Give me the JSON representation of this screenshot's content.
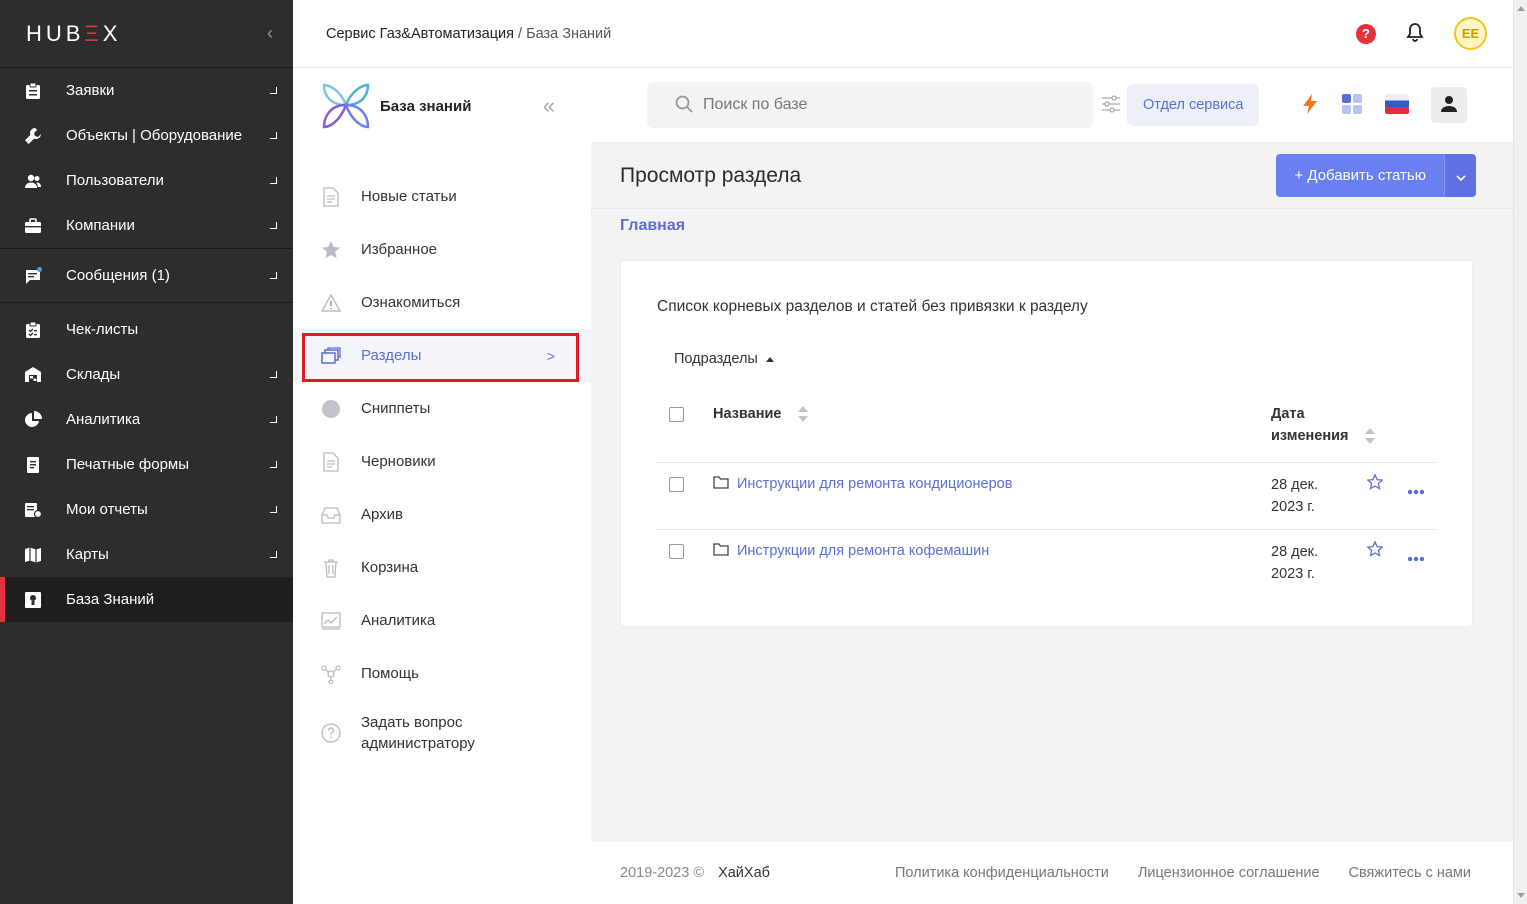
{
  "app": {
    "logo": {
      "part1": "HUB",
      "part2": "Ξ",
      "part3": "X"
    },
    "collapse_glyph": "‹"
  },
  "sidebar": {
    "items": [
      {
        "label": "Заявки",
        "icon": "clipboard-icon"
      },
      {
        "label": "Объекты | Оборудование",
        "icon": "wrench-icon"
      },
      {
        "label": "Пользователи",
        "icon": "users-icon"
      },
      {
        "label": "Компании",
        "icon": "briefcase-icon"
      },
      {
        "label": "Сообщения (1)",
        "icon": "chat-icon"
      },
      {
        "label": "Чек-листы",
        "icon": "checklist-icon"
      },
      {
        "label": "Склады",
        "icon": "warehouse-icon"
      },
      {
        "label": "Аналитика",
        "icon": "pie-chart-icon"
      },
      {
        "label": "Печатные формы",
        "icon": "print-form-icon"
      },
      {
        "label": "Мои отчеты",
        "icon": "reports-icon"
      },
      {
        "label": "Карты",
        "icon": "map-icon"
      },
      {
        "label": "База Знаний",
        "icon": "knowledge-base-icon",
        "active": true
      }
    ]
  },
  "header": {
    "breadcrumb_company": "Сервис Газ&Автоматизация",
    "breadcrumb_sep": " / ",
    "breadcrumb_current": "База Знаний",
    "avatar_initials": "EE",
    "help_glyph": "?"
  },
  "kb": {
    "title": "База знаний",
    "collapse_glyph": "«",
    "items": [
      {
        "label": "Новые статьи",
        "icon": "new-articles-icon"
      },
      {
        "label": "Избранное",
        "icon": "star-icon"
      },
      {
        "label": "Ознакомиться",
        "icon": "warning-icon"
      },
      {
        "label": "Разделы",
        "icon": "sections-icon",
        "selected": true
      },
      {
        "label": "Сниппеты",
        "icon": "snippets-icon"
      },
      {
        "label": "Черновики",
        "icon": "drafts-icon"
      },
      {
        "label": "Архив",
        "icon": "archive-icon"
      },
      {
        "label": "Корзина",
        "icon": "trash-icon"
      },
      {
        "label": "Аналитика",
        "icon": "analytics-icon"
      },
      {
        "label": "Помощь",
        "icon": "help-network-icon"
      },
      {
        "label": "Задать вопрос администратору",
        "icon": "question-icon"
      }
    ],
    "selected_chevron": ">"
  },
  "search": {
    "placeholder": "Поиск по базе",
    "value": "",
    "department_label": "Отдел сервиса"
  },
  "page": {
    "title": "Просмотр раздела",
    "add_button": "+  Добавить статью",
    "crumb": "Главная"
  },
  "card": {
    "description": "Список корневых разделов и статей без привязки к разделу",
    "subsections_label": "Подразделы",
    "columns": {
      "name": "Название",
      "date_line1": "Дата",
      "date_line2": "изменения"
    },
    "rows": [
      {
        "name": "Инструкции для ремонта кондиционеров",
        "date_line1": "28 дек.",
        "date_line2": "2023 г."
      },
      {
        "name": "Инструкции для ремонта кофемашин",
        "date_line1": "28 дек.",
        "date_line2": "2023 г."
      }
    ]
  },
  "footer": {
    "copyright": "2019-2023 ©",
    "brand": "ХайХаб",
    "links": [
      "Политика конфиденциальности",
      "Лицензионное соглашение",
      "Свяжитесь с нами"
    ]
  },
  "colors": {
    "accent": "#5a6fd8",
    "button": "#6a7ff0",
    "brand_red": "#e4313c",
    "sidebar_bg": "#2d2d2d"
  }
}
